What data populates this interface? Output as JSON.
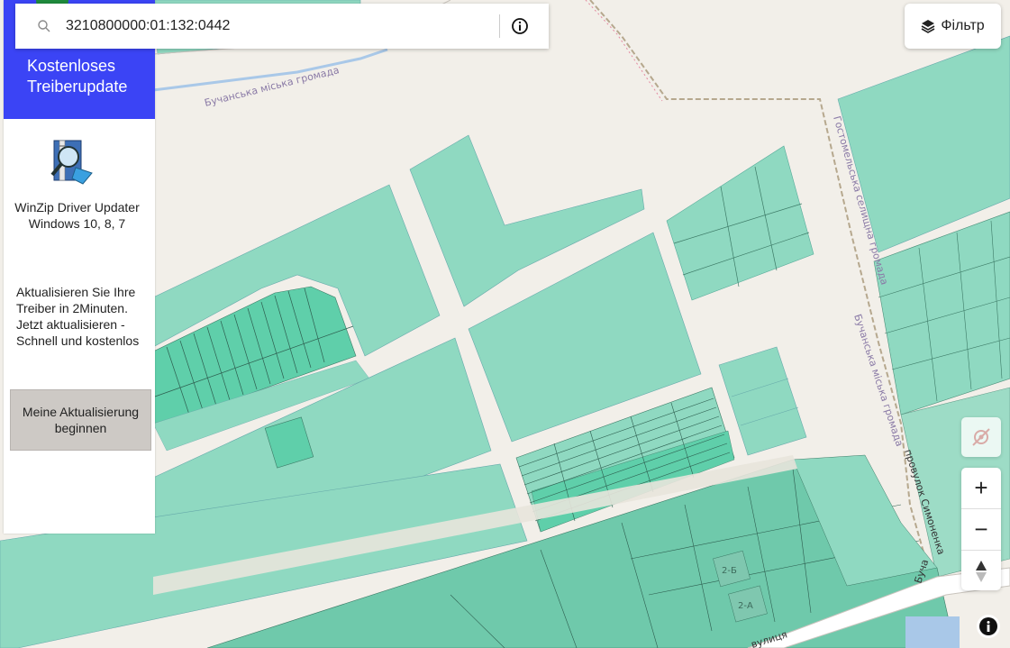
{
  "search": {
    "value": "3210800000:01:132:0442",
    "placeholder": ""
  },
  "filter": {
    "label": "Фільтр"
  },
  "ad": {
    "headline": "Kostenloses Treiberupdate",
    "product": "WinZip Driver Updater Windows 10, 8, 7",
    "body": "Aktualisieren Sie Ihre Treiber in 2Minuten. Jetzt aktualisieren - Schnell und kostenlos",
    "cta": "Meine Aktualisierung beginnen",
    "colors": {
      "header": "#3b44f5",
      "button": "#cdc9c5"
    }
  },
  "map": {
    "labels": {
      "bucha_top": "Бучанська міська громада",
      "gostomel": "Гостомельська селищна громада",
      "bucha_right": "Бучанська міська громада",
      "lane": "провулок Симоненка",
      "street": "вулиця",
      "bucha_edge": "Буча",
      "bld_2b": "2-Б",
      "bld_2a": "2-А"
    },
    "colors": {
      "parcel": "#8fd9c1",
      "parcel_dark": "#5fcfaa",
      "road": "#f2efe9",
      "background": "#f2efe9"
    }
  },
  "controls": {
    "locate": "location-off-icon",
    "zoom_in": "+",
    "zoom_out": "−",
    "compass": "compass-icon",
    "info": "info-icon"
  }
}
